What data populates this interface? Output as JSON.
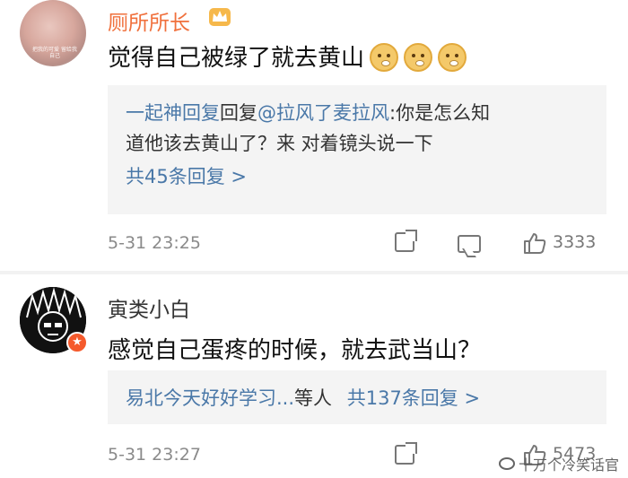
{
  "comments": [
    {
      "username": "厕所所长",
      "text": "觉得自己被绿了就去黄山",
      "avatar_caption": "把我的可爱 留给我自己",
      "replies": {
        "line1_user": "一起神回复",
        "line1_mid": "回复",
        "line1_target": "@拉风了麦拉风",
        "line1_text": ":你是怎么知",
        "line2_text": "道他该去黄山了？来 对着镜头说一下",
        "count_label": "共45条回复 >"
      },
      "timestamp": "5-31 23:25",
      "like_count": "3333"
    },
    {
      "username": "寅类小白",
      "text": "感觉自己蛋疼的时候，就去武当山？",
      "replies": {
        "preview_users": "易北今天好好学习...",
        "preview_suffix": "等人",
        "count_label": "共137条回复 >"
      },
      "timestamp": "5-31 23:27",
      "like_count": "5473"
    }
  ],
  "watermark": "十万个冷笑话官",
  "icons": {
    "crown": "crown-icon",
    "emoji": "doge-emoji-icon",
    "share": "share-icon",
    "comment": "comment-icon",
    "like": "thumbs-up-icon"
  }
}
